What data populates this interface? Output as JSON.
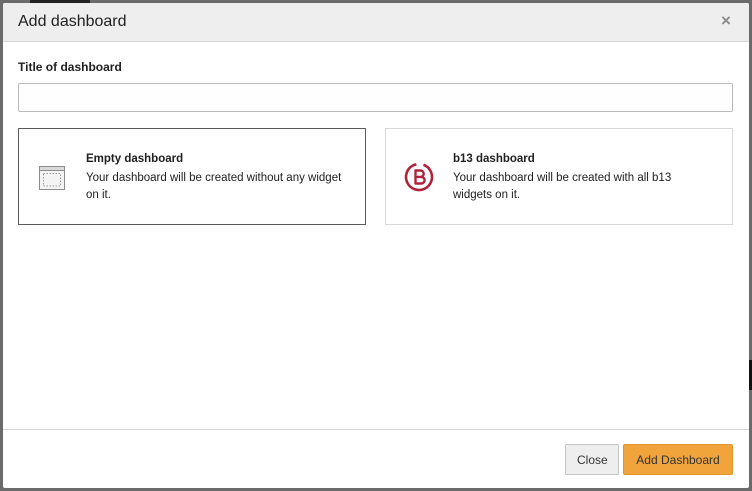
{
  "modal": {
    "title": "Add dashboard",
    "close_glyph": "×"
  },
  "form": {
    "title_label": "Title of dashboard",
    "title_value": "",
    "title_placeholder": ""
  },
  "options": [
    {
      "title": "Empty dashboard",
      "description": "Your dashboard will be created without any widget on it.",
      "icon": "empty-dashboard-icon",
      "selected": true
    },
    {
      "title": "b13 dashboard",
      "description": "Your dashboard will be created with all b13 widgets on it.",
      "icon": "b13-logo-icon",
      "selected": false
    }
  ],
  "footer": {
    "close_label": "Close",
    "add_label": "Add Dashboard"
  },
  "colors": {
    "accent": "#f0a43b",
    "b13_brand": "#b0233c"
  }
}
